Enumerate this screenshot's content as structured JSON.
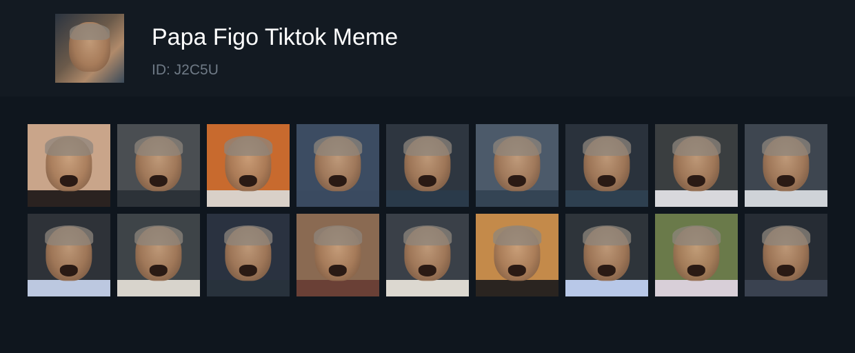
{
  "header": {
    "title": "Papa Figo Tiktok Meme",
    "id_label": "ID: J2C5U"
  },
  "colors": {
    "page_background": "#0f161e",
    "header_background": "#131a22",
    "title_text": "#ffffff",
    "id_text": "#6f7a86"
  },
  "thumbnails": [
    {
      "bg": "#c9a58a",
      "shirt": "#2a2220"
    },
    {
      "bg": "#4a4e52",
      "shirt": "#2c3238"
    },
    {
      "bg": "#c86a2e",
      "shirt": "#d9d0c8"
    },
    {
      "bg": "#3c4c62",
      "shirt": "#3a4a60"
    },
    {
      "bg": "#2e3640",
      "shirt": "#2a3a4a"
    },
    {
      "bg": "#4c5a6a",
      "shirt": "#344454"
    },
    {
      "bg": "#2a323c",
      "shirt": "#2e4050"
    },
    {
      "bg": "#3a3e40",
      "shirt": "#d8d8dc"
    },
    {
      "bg": "#3e4650",
      "shirt": "#cfd3d8"
    },
    {
      "bg": "#2e3238",
      "shirt": "#bcc8e0"
    },
    {
      "bg": "#3e4448",
      "shirt": "#d8d4cc"
    },
    {
      "bg": "#2a3240",
      "shirt": "#28323c"
    },
    {
      "bg": "#8a6a52",
      "shirt": "#6a4036"
    },
    {
      "bg": "#3a4048",
      "shirt": "#dcd8d0"
    },
    {
      "bg": "#c48a4a",
      "shirt": "#2a2420"
    },
    {
      "bg": "#2e343a",
      "shirt": "#b8c8e8"
    },
    {
      "bg": "#6a7a4a",
      "shirt": "#d8cfd8"
    },
    {
      "bg": "#262c34",
      "shirt": "#3a4250"
    }
  ]
}
